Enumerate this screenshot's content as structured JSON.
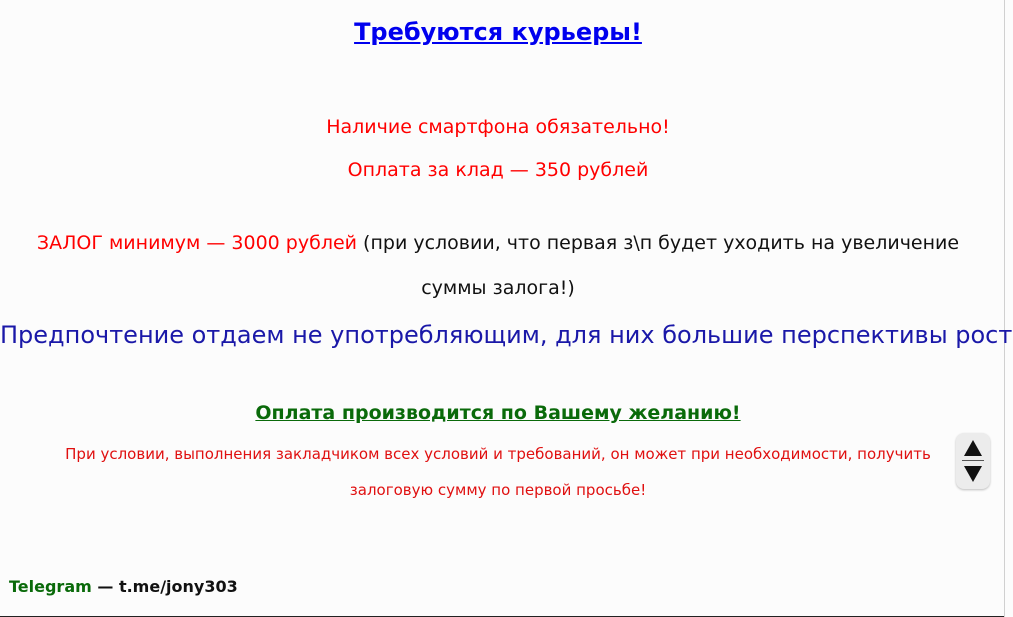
{
  "title": "Требуются курьеры!",
  "requirements": {
    "smartphone": "Наличие смартфона обязательно!",
    "payment_per_stash": "Оплата за клад — 350 рублей"
  },
  "deposit": {
    "amount": "ЗАЛОГ минимум — 3000 рублей",
    "condition_part1": " (при условии, что первая з\\п будет уходить на увеличение",
    "condition_part2": "суммы залога!)"
  },
  "preference": "Предпочтение отдаем не употребляющим, для них большие перспективы роста!",
  "payment_option": "Оплата производится по Вашему желанию!",
  "deposit_return": {
    "line1": "При условии, выполнения закладчиком всех условий и требований, он может при необходимости, получить",
    "line2": "залоговую сумму по первой просьбе!"
  },
  "contact": {
    "label": "Telegram",
    "separator": " — ",
    "handle": "t.me/jony303"
  },
  "scroll_controls": {
    "up_icon": "triangle-up-icon",
    "down_icon": "triangle-down-icon"
  },
  "colors": {
    "title_link": "#0000ee",
    "warning_red": "#ff0000",
    "preference_blue": "#1a18a8",
    "payment_green": "#0a6a0a"
  }
}
